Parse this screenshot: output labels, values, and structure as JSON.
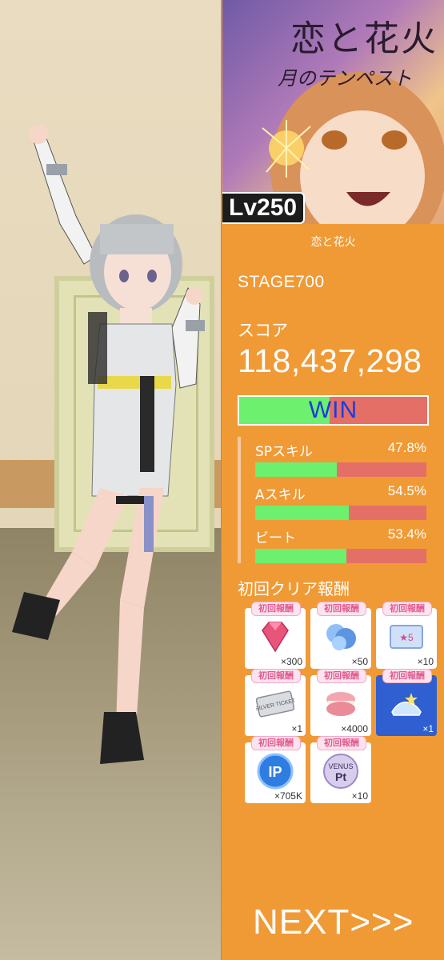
{
  "cover": {
    "title": "恋と花火",
    "subtitle": "月のテンペスト"
  },
  "level_badge": "Lv250",
  "song_title": "恋と花火",
  "stage": "STAGE700",
  "score": {
    "label": "スコア",
    "value": "118,437,298"
  },
  "result": {
    "label": "WIN",
    "ratio": 0.48
  },
  "skills": [
    {
      "name": "SPスキル",
      "percent_text": "47.8%",
      "value": 47.8
    },
    {
      "name": "Aスキル",
      "percent_text": "54.5%",
      "value": 54.5
    },
    {
      "name": "ビート",
      "percent_text": "53.4%",
      "value": 53.4
    }
  ],
  "rewards_title": "初回クリア報酬",
  "rewards": [
    {
      "tag": "初回報酬",
      "icon": "gem-icon",
      "qty": "×300",
      "color": "#e8547a"
    },
    {
      "tag": "初回報酬",
      "icon": "blue-crystal-icon",
      "qty": "×50",
      "color": "#6fa6e8"
    },
    {
      "tag": "初回報酬",
      "icon": "star5-ticket-icon",
      "qty": "×10",
      "color": "#8aa6dc"
    },
    {
      "tag": "初回報酬",
      "icon": "silver-ticket-icon",
      "qty": "×1",
      "color": "#b8bcc2"
    },
    {
      "tag": "初回報酬",
      "icon": "macaron-icon",
      "qty": "×4000",
      "color": "#f0a0a8"
    },
    {
      "tag": "初回報酬",
      "icon": "glass-slipper-icon",
      "qty": "×1",
      "color": "#4a74d8"
    },
    {
      "tag": "初回報酬",
      "icon": "ip-coin-icon",
      "qty": "×705K",
      "color": "#2f7de0"
    },
    {
      "tag": "初回報酬",
      "icon": "venus-pt-icon",
      "qty": "×10",
      "color": "#c7b6e0"
    }
  ],
  "silver_ticket_text": "SILVER TICKET",
  "ip_text": "IP",
  "venus_text": "VENUS",
  "venus_pt_text": "Pt",
  "star5_text": "★5",
  "next_button": "NEXT>>>"
}
